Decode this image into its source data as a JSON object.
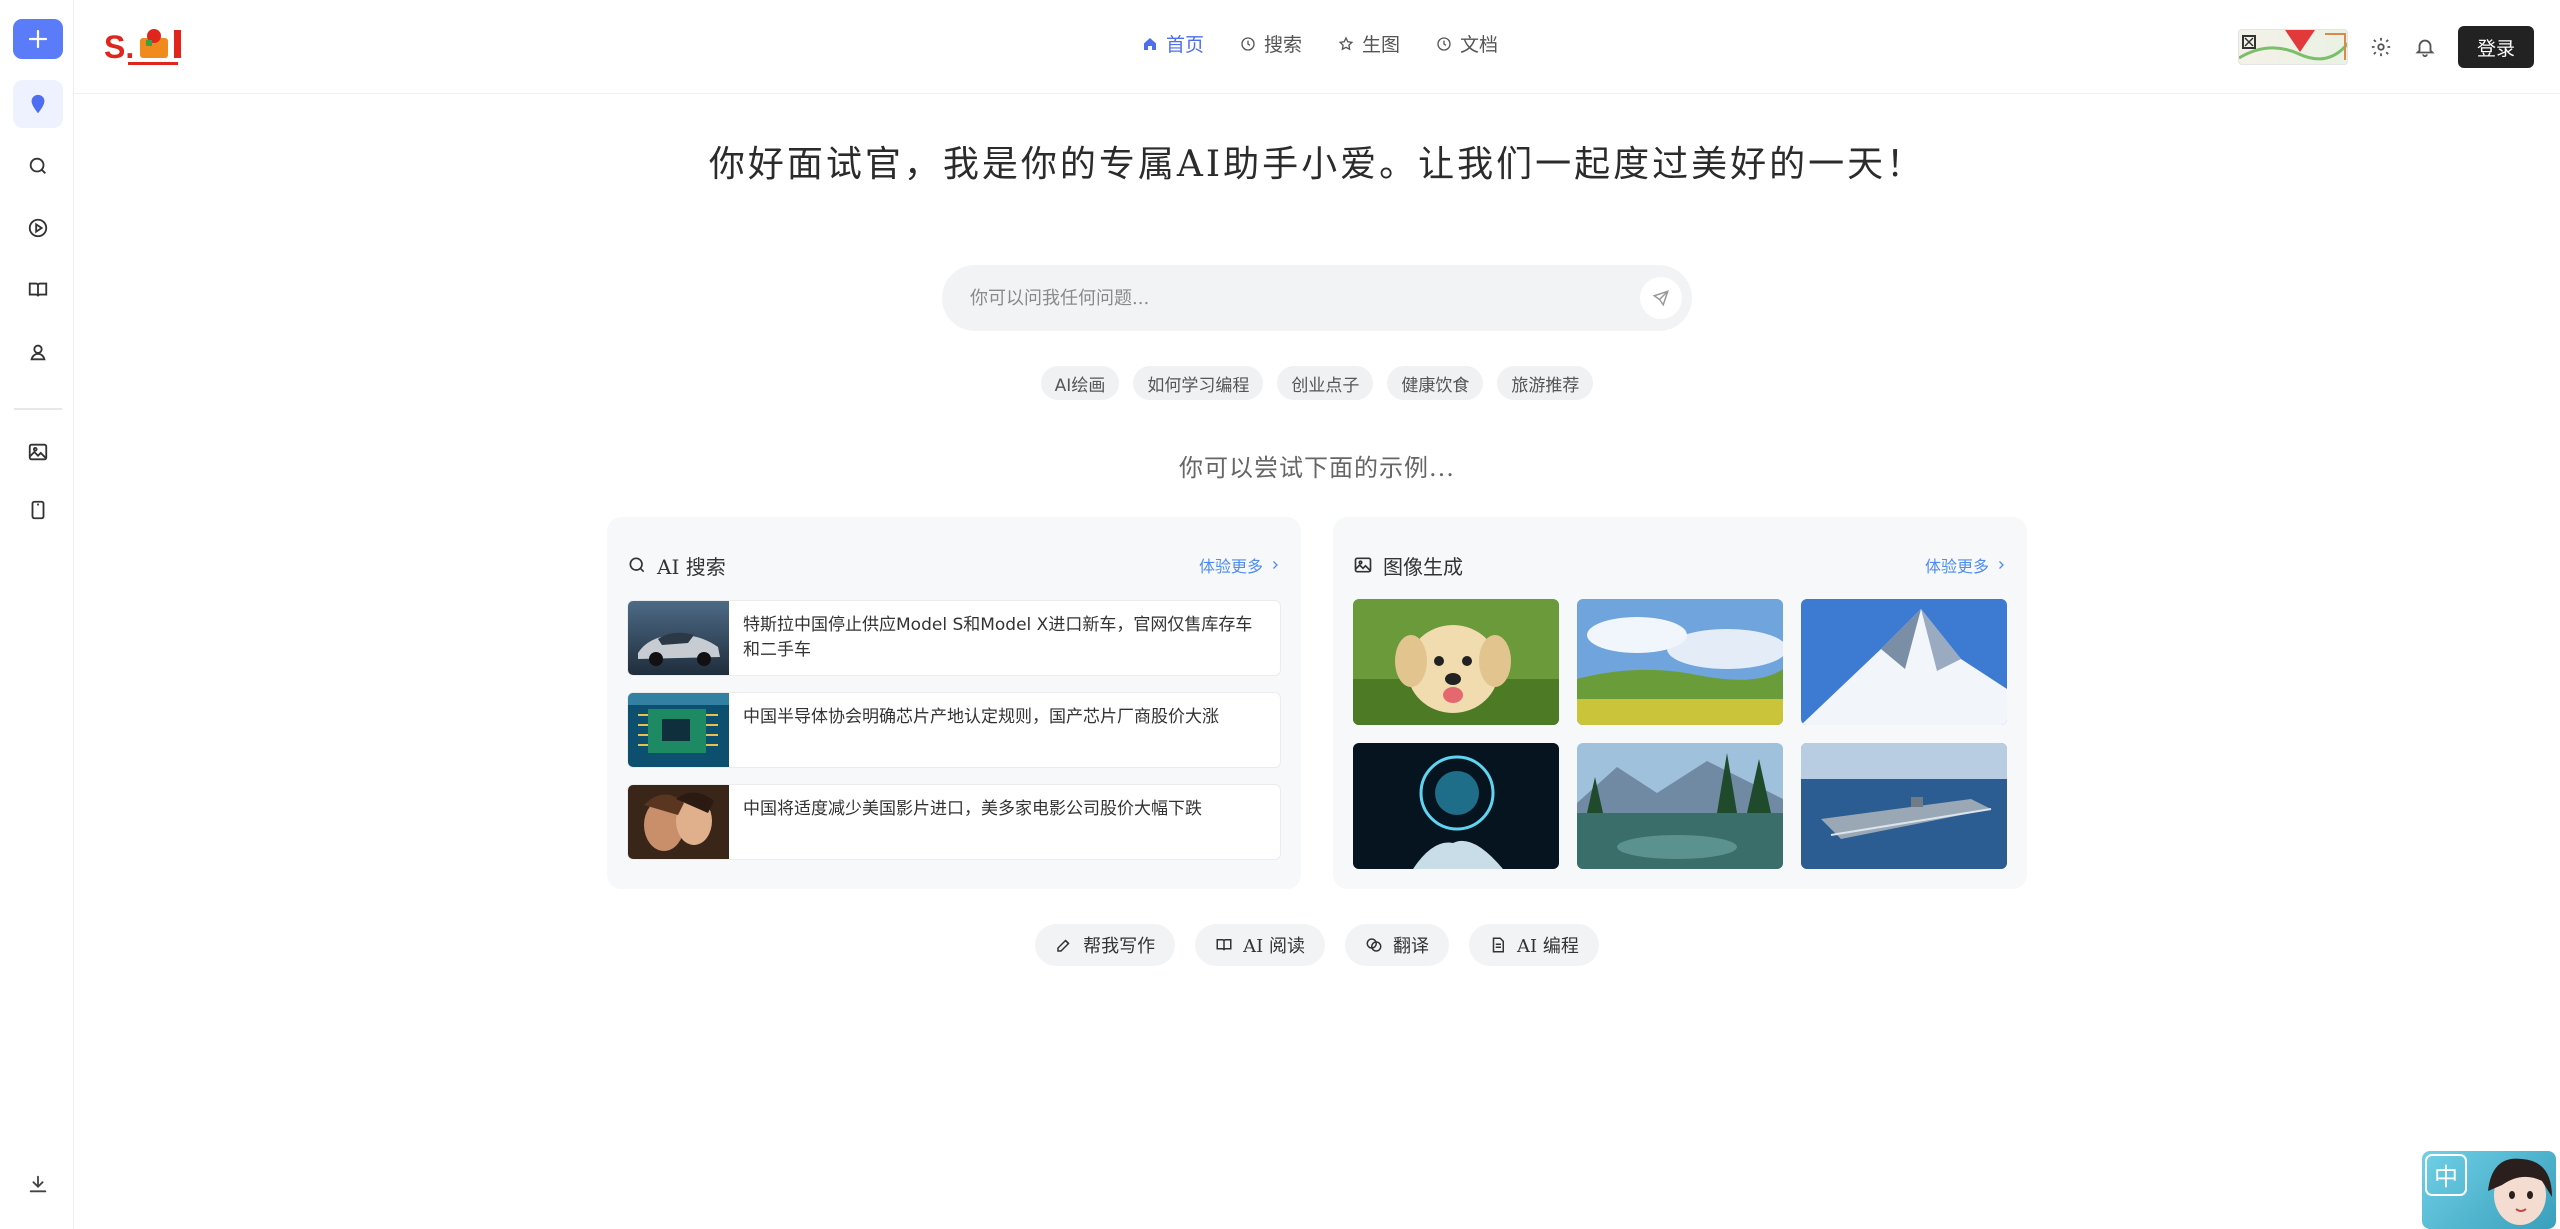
{
  "rail": {
    "items": [
      {
        "name": "assistant"
      },
      {
        "name": "search"
      },
      {
        "name": "video"
      },
      {
        "name": "read"
      },
      {
        "name": "user"
      },
      {
        "name": "image"
      },
      {
        "name": "mobile"
      }
    ]
  },
  "header": {
    "logo_text": "S.",
    "nav": [
      {
        "label": "首页",
        "icon": "home-icon",
        "active": true
      },
      {
        "label": "搜索",
        "icon": "clock-icon"
      },
      {
        "label": "生图",
        "icon": "star-icon"
      },
      {
        "label": "文档",
        "icon": "clock-icon"
      }
    ],
    "login_label": "登录"
  },
  "main": {
    "greeting": "你好面试官，我是你的专属AI助手小爱。让我们一起度过美好的一天！",
    "search_placeholder": "你可以问我任何问题...",
    "chips": [
      "AI绘画",
      "如何学习编程",
      "创业点子",
      "健康饮食",
      "旅游推荐"
    ],
    "examples_hint": "你可以尝试下面的示例...",
    "search_card": {
      "title": "AI 搜索",
      "more": "体验更多",
      "news": [
        "特斯拉中国停止供应Model S和Model X进口新车，官网仅售库存车和二手车",
        "中国半导体协会明确芯片产地认定规则，国产芯片厂商股价大涨",
        "中国将适度减少美国影片进口，美多家电影公司股价大幅下跌"
      ]
    },
    "image_card": {
      "title": "图像生成",
      "more": "体验更多"
    },
    "tools": [
      {
        "label": "帮我写作",
        "icon": "edit-icon"
      },
      {
        "label": "AI 阅读",
        "icon": "book-icon"
      },
      {
        "label": "翻译",
        "icon": "translate-icon"
      },
      {
        "label": "AI 编程",
        "icon": "document-icon"
      }
    ]
  },
  "widget": {
    "label": "中"
  },
  "colors": {
    "accent": "#4e6ef2",
    "link": "#4e8cf2",
    "dark_button": "#222222"
  }
}
